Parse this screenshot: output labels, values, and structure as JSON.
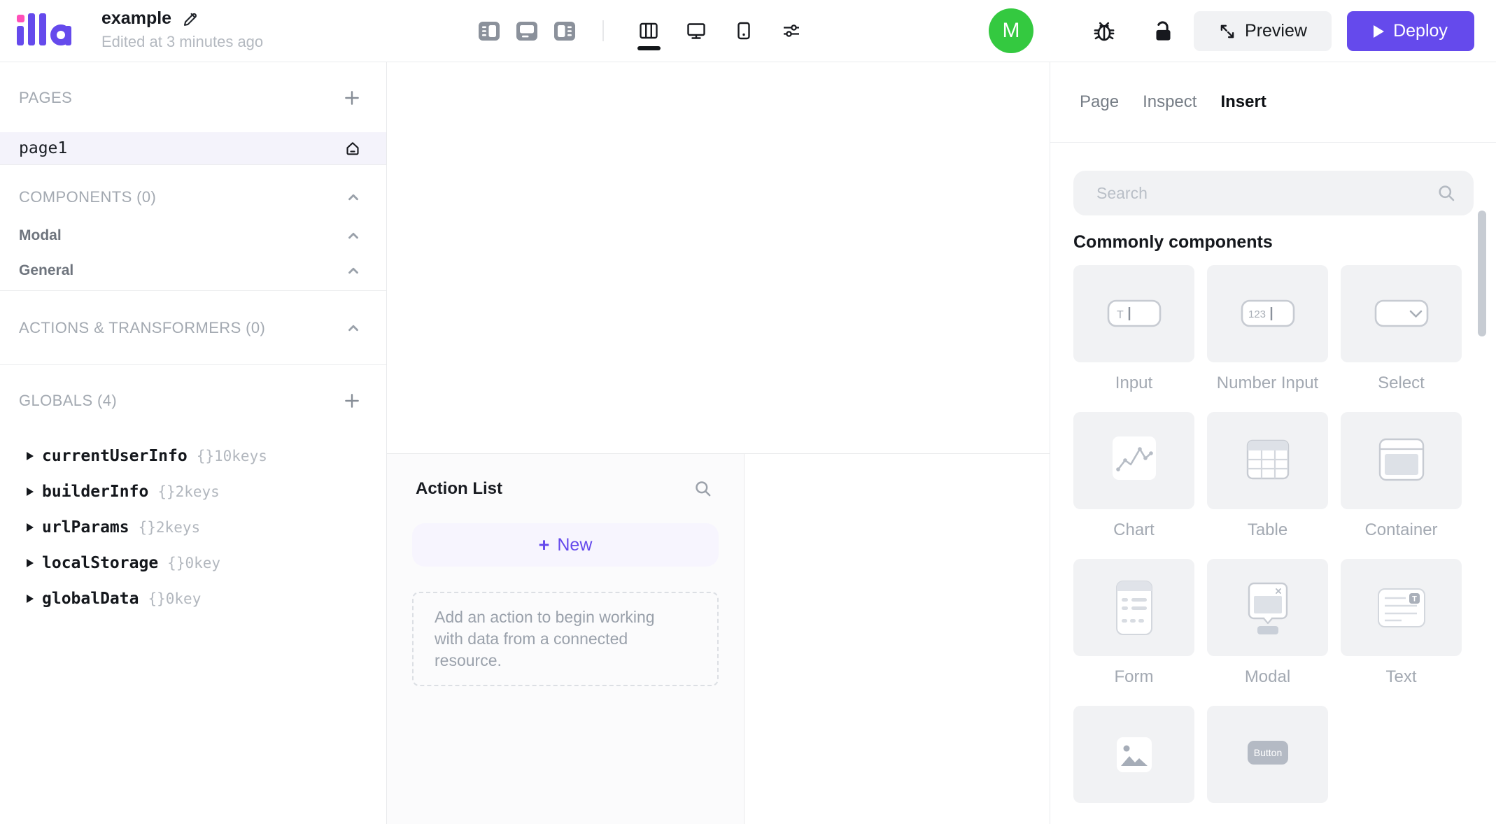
{
  "topbar": {
    "logo_text": "illa",
    "app_name": "example",
    "edited_status": "Edited at 3 minutes ago",
    "avatar_initial": "M",
    "preview_label": "Preview",
    "deploy_label": "Deploy"
  },
  "left_sidebar": {
    "pages": {
      "header": "PAGES",
      "active_page": "page1"
    },
    "components": {
      "header": "COMPONENTS (0)",
      "groups": [
        {
          "label": "Modal"
        },
        {
          "label": "General"
        }
      ]
    },
    "actions_transformers": {
      "header": "ACTIONS & TRANSFORMERS (0)"
    },
    "globals": {
      "header": "GLOBALS (4)",
      "items": [
        {
          "name": "currentUserInfo",
          "keys": "{}10keys"
        },
        {
          "name": "builderInfo",
          "keys": "{}2keys"
        },
        {
          "name": "urlParams",
          "keys": "{}2keys"
        },
        {
          "name": "localStorage",
          "keys": "{}0key"
        },
        {
          "name": "globalData",
          "keys": "{}0key"
        }
      ]
    }
  },
  "action_panel": {
    "title": "Action List",
    "new_button": {
      "plus": "+",
      "label": "New"
    },
    "empty_hint": "Add an action to begin working with data from a connected resource."
  },
  "right_panel": {
    "tabs": [
      {
        "label": "Page",
        "active": false
      },
      {
        "label": "Inspect",
        "active": false
      },
      {
        "label": "Insert",
        "active": true
      }
    ],
    "search_placeholder": "Search",
    "section_title": "Commonly components",
    "components": [
      {
        "label": "Input",
        "icon": "input-icon",
        "icon_text": "T"
      },
      {
        "label": "Number Input",
        "icon": "number-input-icon",
        "icon_text": "123"
      },
      {
        "label": "Select",
        "icon": "select-icon"
      },
      {
        "label": "Chart",
        "icon": "chart-icon"
      },
      {
        "label": "Table",
        "icon": "table-icon"
      },
      {
        "label": "Container",
        "icon": "container-icon"
      },
      {
        "label": "Form",
        "icon": "form-icon"
      },
      {
        "label": "Modal",
        "icon": "modal-icon"
      },
      {
        "label": "Text",
        "icon": "text-icon",
        "icon_text": "T"
      },
      {
        "label": "",
        "icon": "image-icon"
      },
      {
        "label": "",
        "icon": "button-icon",
        "icon_text": "Button"
      }
    ]
  },
  "colors": {
    "accent_purple": "#654aec",
    "logo_pink": "#ff4fb9",
    "avatar_green": "#34c940",
    "new_button_bg": "#f7f5fe",
    "active_page_bg": "#f4f3fb"
  }
}
